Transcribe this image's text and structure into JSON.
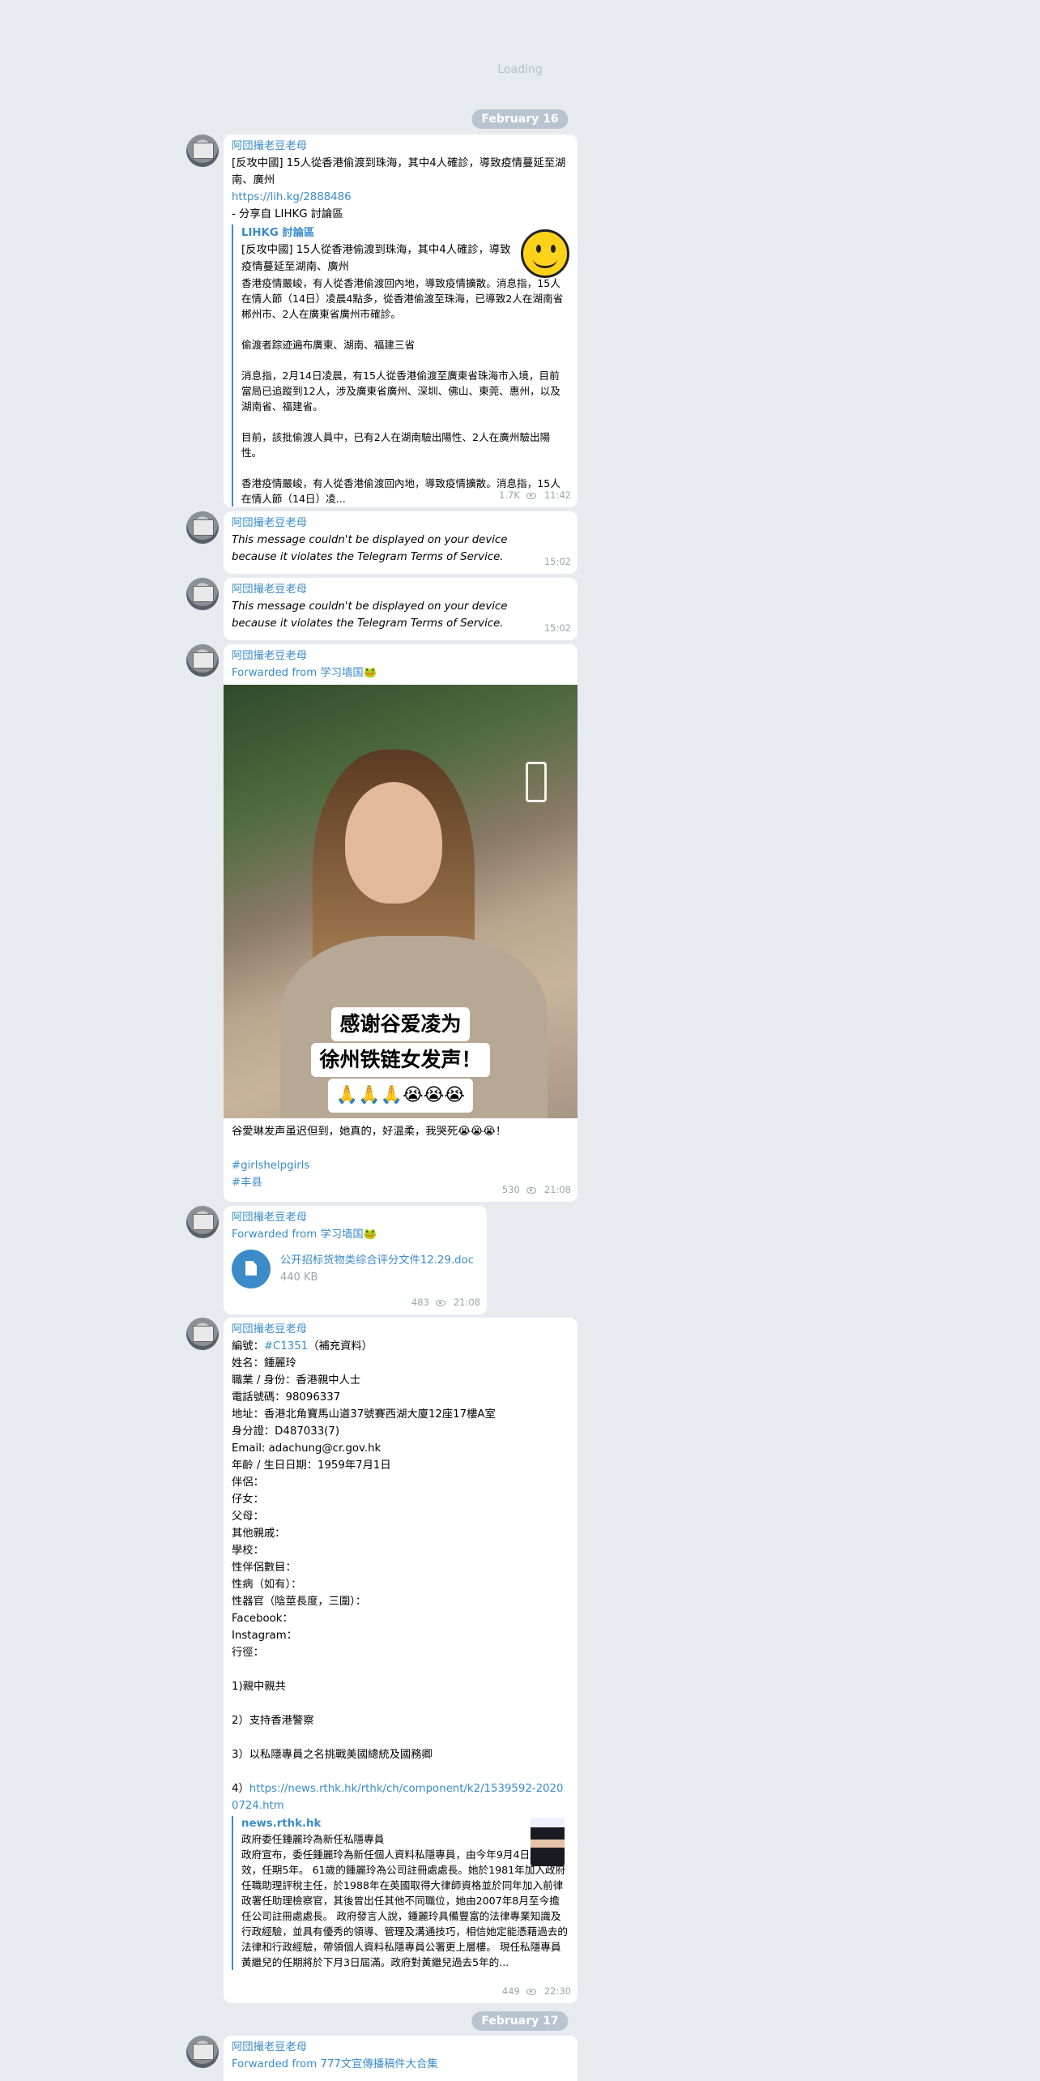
{
  "loading": "Loading",
  "date1": "February 16",
  "date2": "February 17",
  "sender": "阿団撮老豆老母",
  "m1": {
    "title": "[反攻中國] 15人從香港偷渡到珠海，其中4人確診，導致疫情蔓延至湖南、廣州",
    "url": "https://lih.kg/2888486",
    "share": "- 分享自 LIHKG 討論區",
    "preview_site": "LIHKG 討論區",
    "preview_title": "[反攻中國] 15人從香港偷渡到珠海，其中4人確診，導致疫情蔓延至湖南、廣州",
    "preview_body": "香港疫情嚴峻，有人從香港偷渡回內地，導致疫情擴散。消息指，15人在情人節（14日）凌晨4點多，從香港偷渡至珠海，已導致2人在湖南省郴州市、2人在廣東省廣州市確診。\n\n偷渡者踪迹遍布廣東、湖南、福建三省\n\n消息指，2月14日凌晨，有15人從香港偷渡至廣東省珠海市入境，目前當局已追蹤到12人，涉及廣東省廣州、深圳、佛山、東莞、惠州，以及湖南省、福建省。\n\n目前，該批偷渡人員中，已有2人在湖南驗出陽性、2人在廣州驗出陽性。\n\n香港疫情嚴峻，有人從香港偷渡回內地，導致疫情擴散。消息指，15人在情人節（14日）凌...",
    "views": "1.7K",
    "time": "11:42"
  },
  "m2": {
    "text": "This message couldn't be displayed on your device because it violates the Telegram Terms of Service.",
    "time": "15:02"
  },
  "m3": {
    "text": "This message couldn't be displayed on your device because it violates the Telegram Terms of Service.",
    "time": "15:02"
  },
  "m4": {
    "forwarded": "Forwarded from 学习墙国🐸",
    "caption_line1": "感谢谷爱凌为",
    "caption_line2": "徐州铁链女发声！",
    "caption_line3": "🙏🙏🙏😭😭😭",
    "text": "谷愛琳发声虽迟但到，她真的，好温柔，我哭死😭😭😭！",
    "tag1": "#girlshelpgirls",
    "tag2": "#丰县",
    "views": "530",
    "time": "21:08"
  },
  "m5": {
    "forwarded": "Forwarded from 学习墙国🐸",
    "file_name": "公开招标货物类综合评分文件12.29.doc",
    "file_size": "440 KB",
    "views": "483",
    "time": "21:08"
  },
  "m6": {
    "code_prefix": "編號：",
    "code_tag": "#C1351",
    "code_suffix": "（補充資料）",
    "lines": [
      "姓名：鍾麗玲",
      "職業 / 身份：香港親中人士",
      "電話號碼：98096337",
      "地址：香港北角寶馬山道37號賽西湖大廈12座17樓A室",
      "身分證：D487033(7)",
      "Email: adachung@cr.gov.hk",
      "年齡 / 生日日期：1959年7月1日",
      "伴侶：",
      "仔女：",
      "父母：",
      "其他親戚：",
      "學校：",
      "性伴侶數目：",
      "性病（如有）：",
      "性器官（陰莖長度，三圍）：",
      "Facebook：",
      "Instagram：",
      "行徑：",
      "",
      "1)親中親共",
      "",
      "2）支持香港警察",
      "",
      "3）以私隱專員之名挑戰美國總統及國務卿",
      ""
    ],
    "item4_prefix": "4）",
    "item4_url": "https://news.rthk.hk/rthk/ch/component/k2/1539592-20200724.htm",
    "preview_site": "news.rthk.hk",
    "preview_title": "政府委任鍾麗玲為新任私隱專員",
    "preview_body": "政府宣布，委任鍾麗玲為新任個人資料私隱專員，由今年9月4日起生效，任期5年。 61歲的鍾麗玲為公司註冊處處長。她於1981年加入政府任職助理評稅主任，於1988年在英國取得大律師資格並於同年加入前律政署任助理檢察官，其後曾出任其他不同職位，她由2007年8月至今擔任公司註冊處處長。 政府發言人說，鍾麗玲具備豐富的法律專業知識及行政經驗，並具有優秀的領導、管理及溝通技巧，相信她定能憑藉過去的法律和行政經驗，帶領個人資料私隱專員公署更上層樓。 現任私隱專員黃繼兒的任期將於下月3日屆滿。政府對黃繼兒過去5年的...",
    "views": "449",
    "time": "22:30"
  },
  "m7": {
    "forwarded_prefix": "Forwarded from ",
    "forwarded_channel": "777文宣傳播稿件大合集"
  }
}
